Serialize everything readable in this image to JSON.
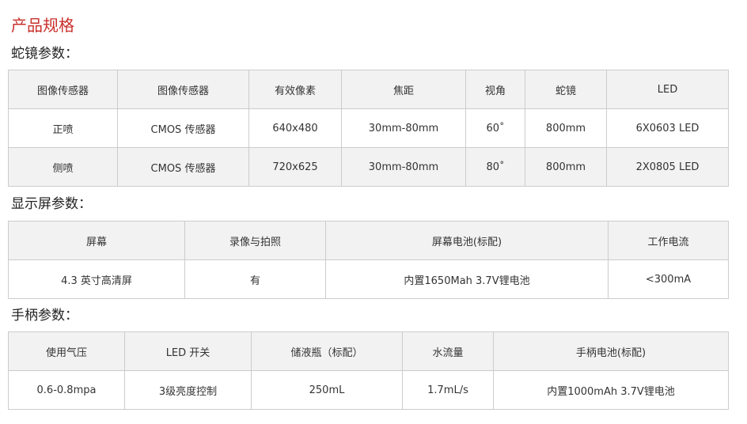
{
  "page_title": "产品规格",
  "sections": [
    {
      "title": "蛇镜参数：",
      "headers": [
        "图像传感器",
        "图像传感器",
        "有效像素",
        "焦距",
        "视角",
        "蛇镜",
        "LED"
      ],
      "rows": [
        [
          "正喷",
          "CMOS 传感器",
          "640x480",
          "30mm-80mm",
          "60˚",
          "800mm",
          "6X0603 LED"
        ],
        [
          "侧喷",
          "CMOS 传感器",
          "720x625",
          "30mm-80mm",
          "80˚",
          "800mm",
          "2X0805 LED"
        ]
      ]
    },
    {
      "title": "显示屏参数：",
      "headers": [
        "屏幕",
        "录像与拍照",
        "屏幕电池(标配)",
        "工作电流"
      ],
      "rows": [
        [
          "4.3 英寸高清屏",
          "有",
          "内置1650Mah 3.7V锂电池",
          "<300mA"
        ]
      ]
    },
    {
      "title": "手柄参数：",
      "headers": [
        "使用气压",
        "LED 开关",
        "储液瓶（标配）",
        "水流量",
        "手柄电池(标配)"
      ],
      "rows": [
        [
          "0.6-0.8mpa",
          "3级亮度控制",
          "250mL",
          "1.7mL/s",
          "内置1000mAh 3.7V锂电池"
        ]
      ]
    }
  ]
}
